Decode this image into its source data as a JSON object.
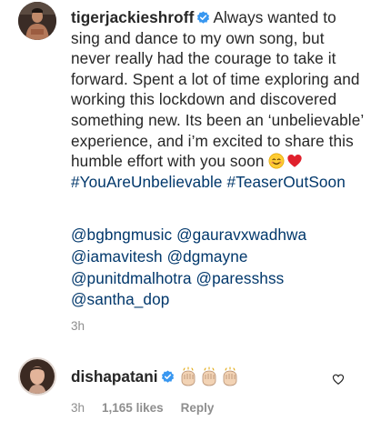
{
  "post": {
    "username": "tigerjackieshroff",
    "caption_text": "Always wanted to sing and dance to my own song, but never really had the courage to take it forward. Spent a lot of time exploring and working this lockdown and discovered something new. Its been an ‘unbelievable’ experience, and i’m excited to share this humble effort with you soon",
    "hashtags": [
      "#YouAreUnbelievable",
      "#TeaserOutSoon"
    ],
    "mentions": [
      "@bgbngmusic",
      "@gauravxwadhwa",
      "@iamavitesh",
      "@dgmayne",
      "@punitdmalhotra",
      "@paresshss",
      "@santha_dop"
    ],
    "time": "3h",
    "emojis": [
      "smiling-face-emoji",
      "red-heart-emoji"
    ]
  },
  "comment": {
    "username": "dishapatani",
    "emojis": [
      "clapping-hands-emoji",
      "clapping-hands-emoji",
      "clapping-hands-emoji"
    ],
    "time": "3h",
    "likes": "1,165 likes",
    "reply": "Reply"
  },
  "colors": {
    "text": "#262626",
    "link": "#00376b",
    "meta": "#8e8e8e",
    "verified": "#3897f0"
  }
}
